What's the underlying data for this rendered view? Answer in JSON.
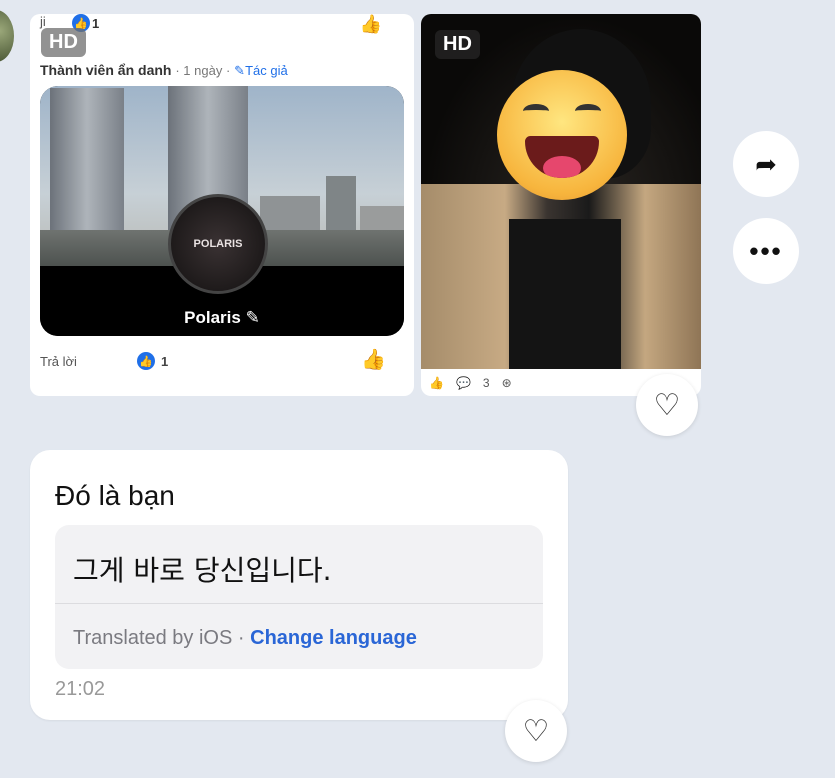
{
  "left_card": {
    "hd": "HD",
    "top_left_fragment": "ji",
    "top_like_count": "1",
    "author_name": "Thành viên ẩn danh",
    "author_meta": "· 1 ngày ·",
    "author_tag": "Tác giả",
    "photo_badge_text": "POLARIS",
    "photo_name": "Polaris",
    "reply_label": "Trả lời",
    "like_count": "1"
  },
  "right_card": {
    "hd": "HD",
    "comment_count": "3"
  },
  "actions": {
    "share_icon": "share-arrow-icon",
    "more_label": "•••"
  },
  "message": {
    "text": "Đó là bạn",
    "translation": "그게 바로 당신입니다.",
    "translated_by": "Translated by iOS",
    "separator": "·",
    "change_language": "Change language",
    "time": "21:02"
  },
  "colors": {
    "background": "#e3e8f0",
    "accent_blue": "#2a66d6"
  }
}
